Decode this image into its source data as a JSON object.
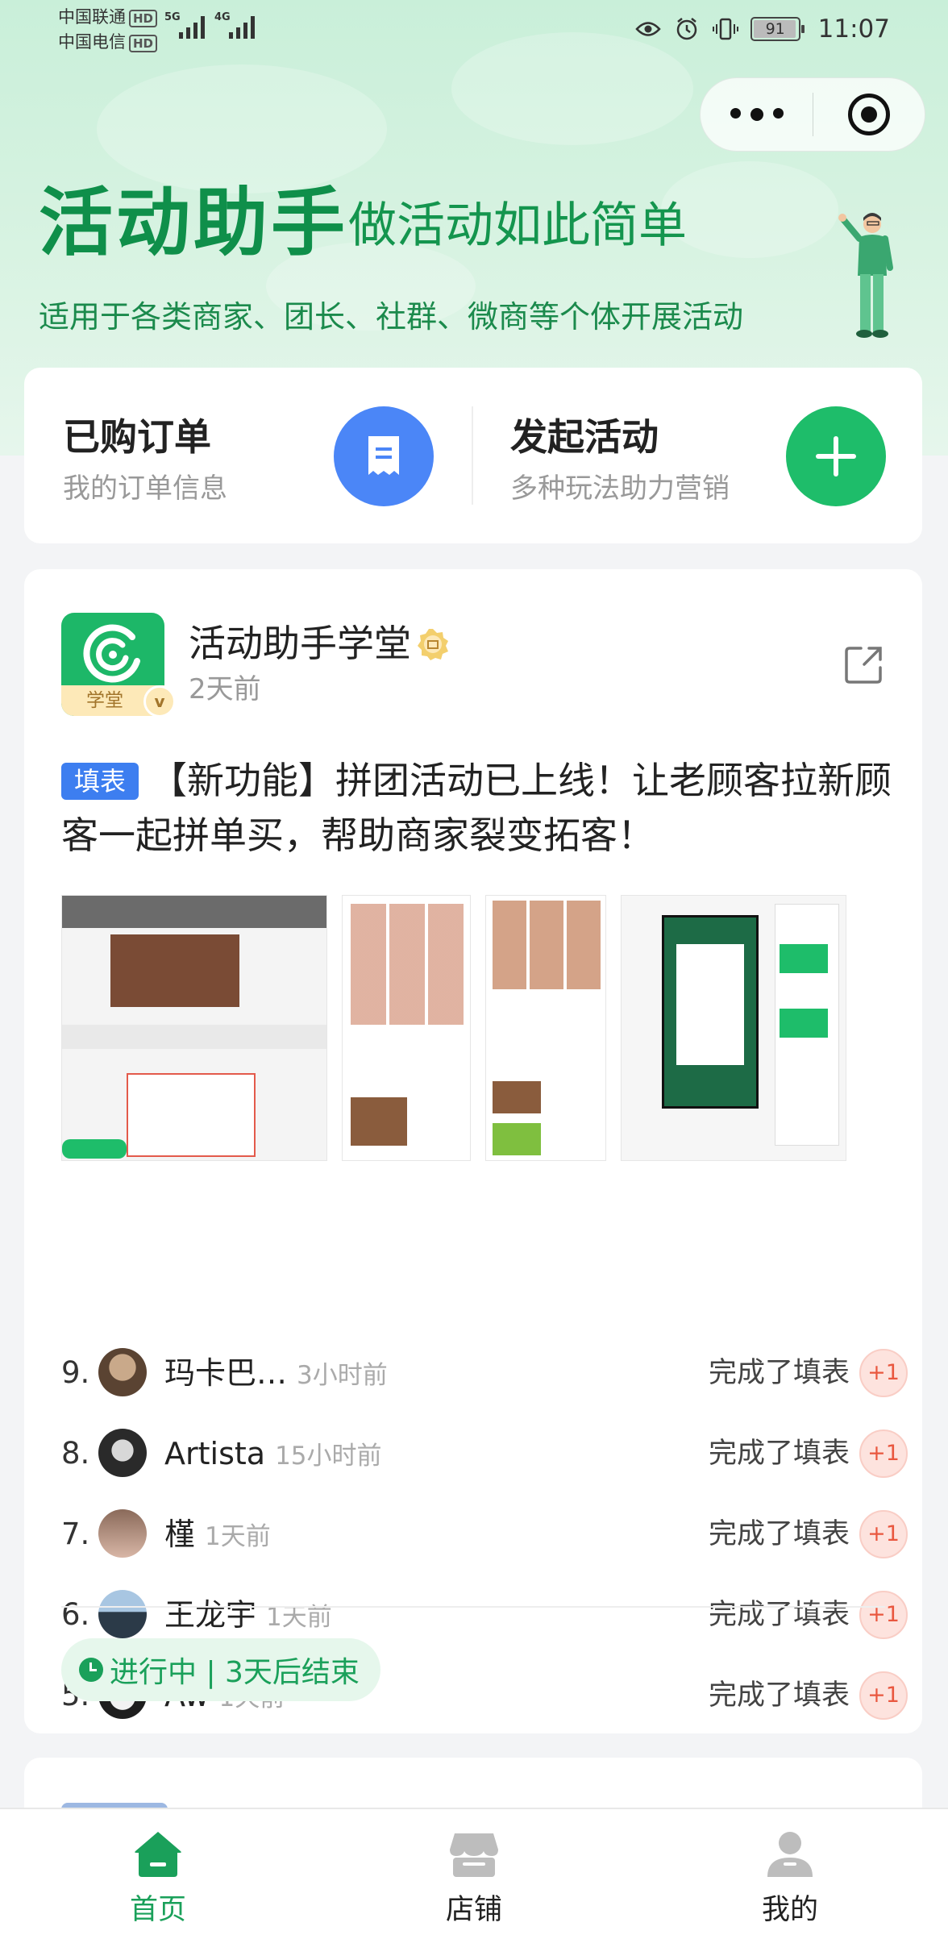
{
  "status_bar": {
    "carrier1": "中国联通",
    "carrier2": "中国电信",
    "hd": "HD",
    "net1": "5G",
    "net2": "4G",
    "battery": "91",
    "time": "11:07"
  },
  "header": {
    "title": "活动助手",
    "subtitle": "做活动如此简单",
    "description": "适用于各类商家、团长、社群、微商等个体开展活动"
  },
  "quick_actions": [
    {
      "title": "已购订单",
      "subtitle": "我的订单信息",
      "icon": "receipt-icon",
      "color": "#4b86f7"
    },
    {
      "title": "发起活动",
      "subtitle": "多种玩法助力营销",
      "icon": "plus-icon",
      "color": "#1ebd6a"
    }
  ],
  "feed": {
    "author": "活动助手学堂",
    "logo_strip": "学堂",
    "time": "2天前",
    "tag": "填表",
    "text": "【新功能】拼团活动已上线！让老顾客拉新顾客一起拼单买，帮助商家裂变拓客！",
    "participants": [
      {
        "rank": "9.",
        "name": "玛卡巴…",
        "time": "3小时前",
        "action": "完成了填表",
        "plus": "+1"
      },
      {
        "rank": "8.",
        "name": "Artista",
        "time": "15小时前",
        "action": "完成了填表",
        "plus": "+1"
      },
      {
        "rank": "7.",
        "name": "槿",
        "time": "1天前",
        "action": "完成了填表",
        "plus": "+1"
      },
      {
        "rank": "6.",
        "name": "王龙宇",
        "time": "1天前",
        "action": "完成了填表",
        "plus": "+1"
      },
      {
        "rank": "5.",
        "name": "Aw",
        "time": "1天前",
        "action": "完成了填表",
        "plus": "+1"
      }
    ],
    "status": "进行中 | 3天后结束"
  },
  "tabbar": [
    {
      "label": "首页",
      "icon": "home-icon",
      "active": true
    },
    {
      "label": "店铺",
      "icon": "shop-icon",
      "active": false
    },
    {
      "label": "我的",
      "icon": "user-icon",
      "active": false
    }
  ],
  "colors": {
    "brand_green": "#1aa05a",
    "blue": "#4b86f7",
    "tag_blue": "#3d7ef0",
    "plus_red": "#e9573f"
  }
}
